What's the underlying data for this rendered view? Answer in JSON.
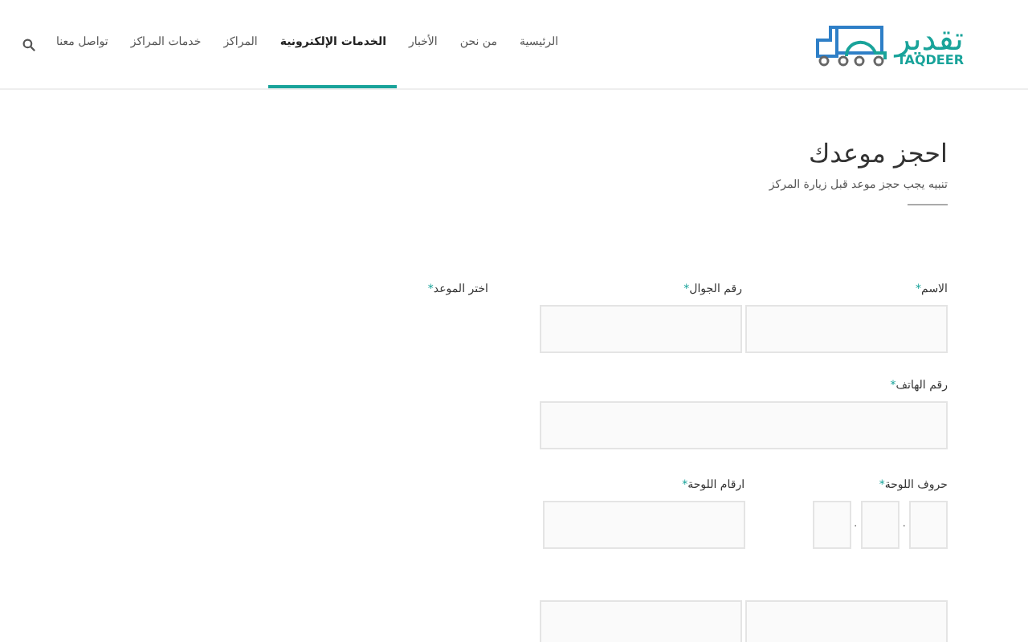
{
  "logo": {
    "name": "تقدير",
    "latin": "TAQDEER"
  },
  "nav": [
    {
      "label": "الرئيسية",
      "selected": false
    },
    {
      "label": "من نحن",
      "selected": false
    },
    {
      "label": "الأخبار",
      "selected": false
    },
    {
      "label": "الخدمات الإلكترونية",
      "selected": true
    },
    {
      "label": "المراكز",
      "selected": false
    },
    {
      "label": "خدمات المراكز",
      "selected": false
    },
    {
      "label": "تواصل معنا",
      "selected": false
    }
  ],
  "page": {
    "title": "احجز موعدك",
    "subtitle": "تنبيه يجب حجز موعد قبل زيارة المركز"
  },
  "form": {
    "required_mark": "*",
    "plate_separator": ".",
    "name": {
      "label": "الاسم"
    },
    "mobile": {
      "label": "رقم الجوال "
    },
    "date": {
      "label": "اختر الموعد"
    },
    "phone": {
      "label": "رقم الهاتف"
    },
    "plate_letters": {
      "label": "حروف اللوحة"
    },
    "plate_numbers": {
      "label": "ارقام اللوحة"
    }
  }
}
